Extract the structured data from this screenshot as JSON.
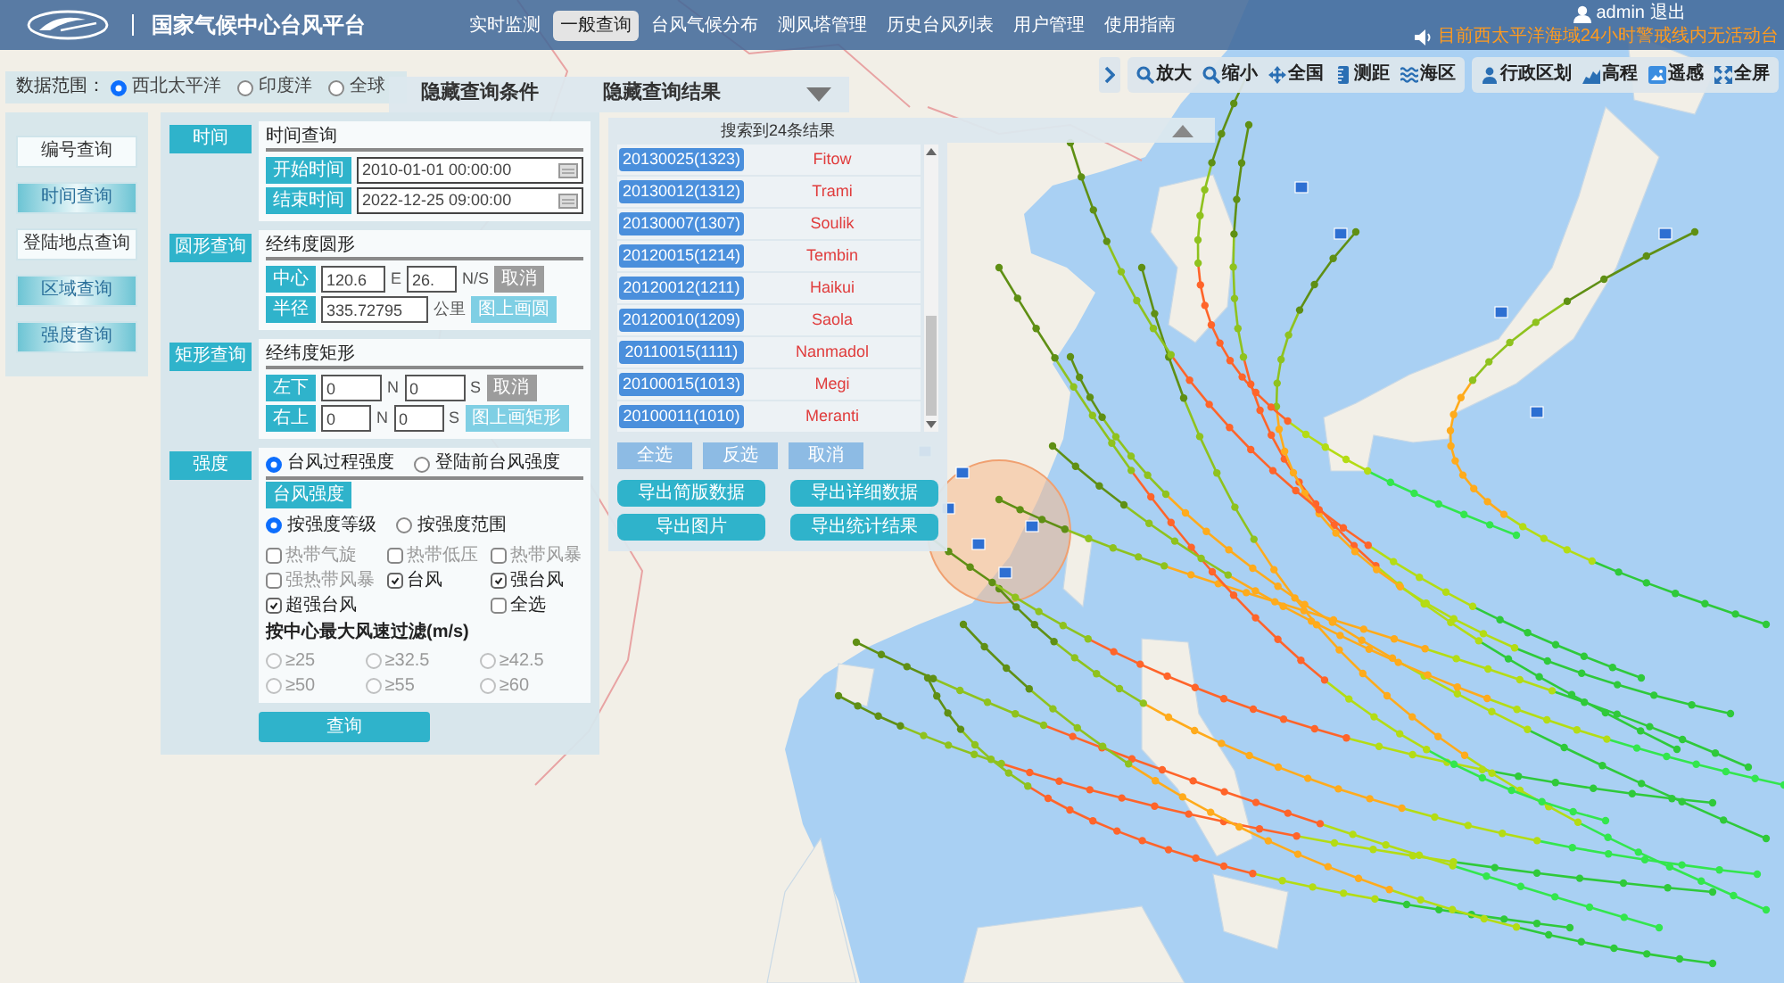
{
  "header": {
    "title": "国家气候中心台风平台",
    "nav": [
      {
        "label": "实时监测",
        "selected": false
      },
      {
        "label": "一般查询",
        "selected": true
      },
      {
        "label": "台风气候分布",
        "selected": false
      },
      {
        "label": "测风塔管理",
        "selected": false
      },
      {
        "label": "历史台风列表",
        "selected": false
      },
      {
        "label": "用户管理",
        "selected": false
      },
      {
        "label": "使用指南",
        "selected": false
      }
    ],
    "user": "admin",
    "logout": "退出",
    "notice": "目前西太平洋海域24小时警戒线内无活动台"
  },
  "data_range": {
    "label": "数据范围：",
    "options": [
      {
        "label": "西北太平洋",
        "selected": true
      },
      {
        "label": "印度洋",
        "selected": false
      },
      {
        "label": "全球",
        "selected": false
      }
    ]
  },
  "panel_toggles": [
    "隐藏查询条件",
    "隐藏查询结果"
  ],
  "map_toolbar": {
    "groups": [
      {
        "tools": [
          {
            "kind": "zoomin",
            "label": "放大"
          },
          {
            "kind": "zoomout",
            "label": "缩小"
          },
          {
            "kind": "pan",
            "label": "全国"
          },
          {
            "kind": "ruler",
            "label": "测距"
          },
          {
            "kind": "waves",
            "label": "海区"
          }
        ]
      },
      {
        "tools": [
          {
            "kind": "person",
            "label": "行政区划"
          },
          {
            "kind": "elevation",
            "label": "高程"
          },
          {
            "kind": "image",
            "label": "遥感"
          },
          {
            "kind": "expand",
            "label": "全屏"
          }
        ]
      }
    ]
  },
  "query_types": [
    {
      "label": "编号查询",
      "selected": false
    },
    {
      "label": "时间查询",
      "selected": true
    },
    {
      "label": "登陆地点查询",
      "selected": false
    },
    {
      "label": "区域查询",
      "selected": true
    },
    {
      "label": "强度查询",
      "selected": true
    }
  ],
  "query_form": {
    "time": {
      "tag": "时间",
      "title": "时间查询",
      "start": {
        "label": "开始时间",
        "value": "2010-01-01 00:00:00"
      },
      "end": {
        "label": "结束时间",
        "value": "2022-12-25 09:00:00"
      }
    },
    "circle": {
      "tag": "圆形查询",
      "title": "经纬度圆形",
      "center": {
        "label": "中心",
        "field_1": "120.6",
        "unit_1": "E",
        "field_2": "26.",
        "unit_2": "N/S",
        "button": {
          "label": "取消",
          "kind": "cancel"
        }
      },
      "radius": {
        "label": "半径",
        "value": "335.72795",
        "unit": "公里",
        "button": {
          "label": "图上画圆",
          "kind": "draw"
        }
      }
    },
    "rectangle": {
      "tag": "矩形查询",
      "title": "经纬度矩形",
      "corners": [
        {
          "label": "左下",
          "field_1": "0",
          "unit_1": "N",
          "field_2": "0",
          "unit_2": "S",
          "button": {
            "label": "取消",
            "kind": "cancel"
          }
        },
        {
          "label": "右上",
          "field_1": "0",
          "unit_1": "N",
          "field_2": "0",
          "unit_2": "S",
          "button": {
            "label": "图上画矩形",
            "kind": "draw"
          }
        }
      ]
    },
    "intensity": {
      "tag": "强度",
      "modes": [
        {
          "label": "台风过程强度",
          "selected": true
        },
        {
          "label": "登陆前台风强度",
          "selected": false
        }
      ],
      "tab": "台风强度",
      "methods": [
        {
          "label": "按强度等级",
          "selected": true
        },
        {
          "label": "按强度范围",
          "selected": false
        }
      ],
      "grades": [
        {
          "label": "热带气旋",
          "checked": false
        },
        {
          "label": "热带低压",
          "checked": false
        },
        {
          "label": "热带风暴",
          "checked": false
        },
        {
          "label": "强热带风暴",
          "checked": false
        },
        {
          "label": "台风",
          "checked": true
        },
        {
          "label": "强台风",
          "checked": true
        },
        {
          "label": "超强台风",
          "checked": true
        }
      ],
      "select_all": {
        "label": "全选",
        "checked": false
      },
      "speed_title": "按中心最大风速过滤(m/s)",
      "speeds": [
        {
          "label": "≥25",
          "selected": false,
          "disabled": true
        },
        {
          "label": "≥32.5",
          "selected": false,
          "disabled": true
        },
        {
          "label": "≥42.5",
          "selected": false,
          "disabled": true
        },
        {
          "label": "≥50",
          "selected": false,
          "disabled": true
        },
        {
          "label": "≥55",
          "selected": false,
          "disabled": true
        },
        {
          "label": "≥60",
          "selected": false,
          "disabled": true
        }
      ]
    },
    "submit": "查询"
  },
  "results": {
    "summary": "搜索到24条结果",
    "rows": [
      {
        "id": "20130025(1323)",
        "name": "Fitow"
      },
      {
        "id": "20130012(1312)",
        "name": "Trami"
      },
      {
        "id": "20130007(1307)",
        "name": "Soulik"
      },
      {
        "id": "20120015(1214)",
        "name": "Tembin"
      },
      {
        "id": "20120012(1211)",
        "name": "Haikui"
      },
      {
        "id": "20120010(1209)",
        "name": "Saola"
      },
      {
        "id": "20110015(1111)",
        "name": "Nanmadol"
      },
      {
        "id": "20100015(1013)",
        "name": "Megi"
      },
      {
        "id": "20100011(1010)",
        "name": "Meranti"
      }
    ],
    "selection_buttons": [
      "全选",
      "反选",
      "取消"
    ],
    "export_buttons": [
      "导出简版数据",
      "导出详细数据",
      "导出图片",
      "导出统计结果"
    ]
  }
}
